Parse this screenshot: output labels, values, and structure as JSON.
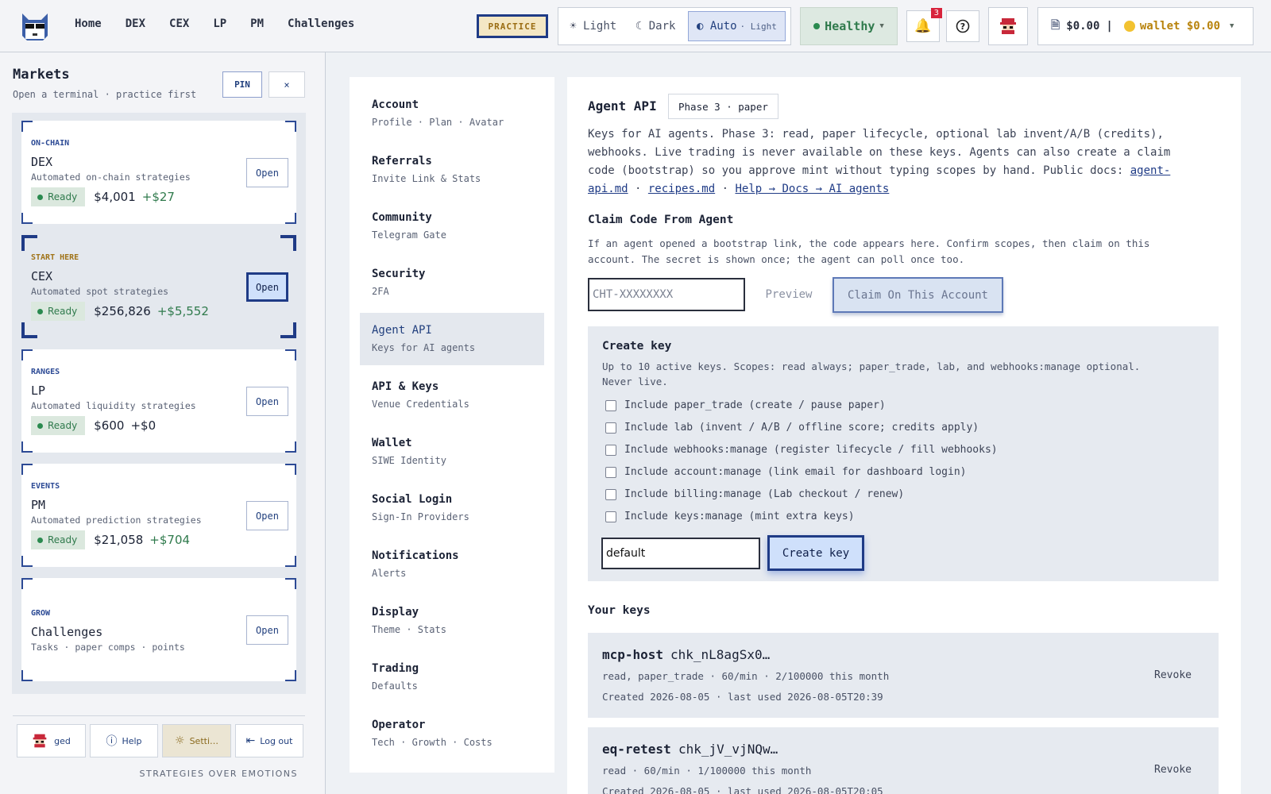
{
  "nav": [
    "Home",
    "DEX",
    "CEX",
    "LP",
    "PM",
    "Challenges"
  ],
  "practice_label": "PRACTICE",
  "theme": {
    "light": "☀ Light",
    "dark": "☾ Dark",
    "auto": "◐ Auto",
    "auto_sub": "· Light"
  },
  "health": "Healthy",
  "notifications_count": "3",
  "wallet": {
    "paper": "$0.00",
    "sep": "|",
    "label": "wallet $0.00"
  },
  "sidebar": {
    "title": "Markets",
    "subtitle": "Open a terminal · practice first",
    "pin": "PIN",
    "close": "×",
    "markets": [
      {
        "tag": "ON-CHAIN",
        "name": "DEX",
        "desc": "Automated on-chain strategies",
        "status": "Ready",
        "value": "$4,001",
        "delta": "+$27",
        "open": "Open"
      },
      {
        "tag": "START HERE",
        "name": "CEX",
        "desc": "Automated spot strategies",
        "status": "Ready",
        "value": "$256,826",
        "delta": "+$5,552",
        "open": "Open"
      },
      {
        "tag": "RANGES",
        "name": "LP",
        "desc": "Automated liquidity strategies",
        "status": "Ready",
        "value": "$600",
        "delta": "+$0",
        "open": "Open"
      },
      {
        "tag": "EVENTS",
        "name": "PM",
        "desc": "Automated prediction strategies",
        "status": "Ready",
        "value": "$21,058",
        "delta": "+$704",
        "open": "Open"
      },
      {
        "tag": "GROW",
        "name": "Challenges",
        "desc": "Tasks · paper comps · points",
        "open": "Open"
      }
    ],
    "footer": {
      "user": "ged",
      "help": "Help",
      "settings": "Setti…",
      "logout": "Log out"
    },
    "tagline": "STRATEGIES OVER EMOTIONS"
  },
  "settings_nav": [
    {
      "title": "Account",
      "sub": "Profile · Plan · Avatar"
    },
    {
      "title": "Referrals",
      "sub": "Invite Link & Stats"
    },
    {
      "title": "Community",
      "sub": "Telegram Gate"
    },
    {
      "title": "Security",
      "sub": "2FA"
    },
    {
      "title": "Agent API",
      "sub": "Keys for AI agents"
    },
    {
      "title": "API & Keys",
      "sub": "Venue Credentials"
    },
    {
      "title": "Wallet",
      "sub": "SIWE Identity"
    },
    {
      "title": "Social Login",
      "sub": "Sign-In Providers"
    },
    {
      "title": "Notifications",
      "sub": "Alerts"
    },
    {
      "title": "Display",
      "sub": "Theme · Stats"
    },
    {
      "title": "Trading",
      "sub": "Defaults"
    },
    {
      "title": "Operator",
      "sub": "Tech · Growth · Costs"
    }
  ],
  "panel": {
    "title": "Agent API",
    "phase": "Phase 3 · paper",
    "desc": "Keys for AI agents. Phase 3: read, paper lifecycle, optional lab invent/A/B (credits), webhooks. Live trading is never available on these keys. Agents can also create a claim code (bootstrap) so you approve mint without typing scopes by hand. Public docs: ",
    "link1": "agent-api.md",
    "sep1": " · ",
    "link2": "recipes.md",
    "sep2": " · ",
    "link3": "Help → Docs → AI agents",
    "claim_title": "Claim Code From Agent",
    "claim_desc": "If an agent opened a bootstrap link, the code appears here. Confirm scopes, then claim on this account. The secret is shown once; the agent can poll once too.",
    "claim_placeholder": "CHT-XXXXXXXX",
    "preview": "Preview",
    "claim_button": "Claim On This Account",
    "create": {
      "title": "Create key",
      "desc": "Up to 10 active keys. Scopes: read always; paper_trade, lab, and webhooks:manage optional. Never live.",
      "scopes": [
        "Include paper_trade (create / pause paper)",
        "Include lab (invent / A/B / offline score; credits apply)",
        "Include webhooks:manage (register lifecycle / fill webhooks)",
        "Include account:manage (link email for dashboard login)",
        "Include billing:manage (Lab checkout / renew)",
        "Include keys:manage (mint extra keys)"
      ],
      "name_value": "default",
      "button": "Create key"
    },
    "keys_title": "Your keys",
    "keys": [
      {
        "name": "mcp-host",
        "id": "chk_nL8agSx0…",
        "meta": "read, paper_trade · 60/min · 2/100000 this month",
        "created": "Created 2026-08-05 · last used 2026-08-05T20:39",
        "revoke": "Revoke"
      },
      {
        "name": "eq-retest",
        "id": "chk_jV_vjNQw…",
        "meta": "read · 60/min · 1/100000 this month",
        "created": "Created 2026-08-05 · last used 2026-08-05T20:05",
        "revoke": "Revoke"
      }
    ]
  }
}
